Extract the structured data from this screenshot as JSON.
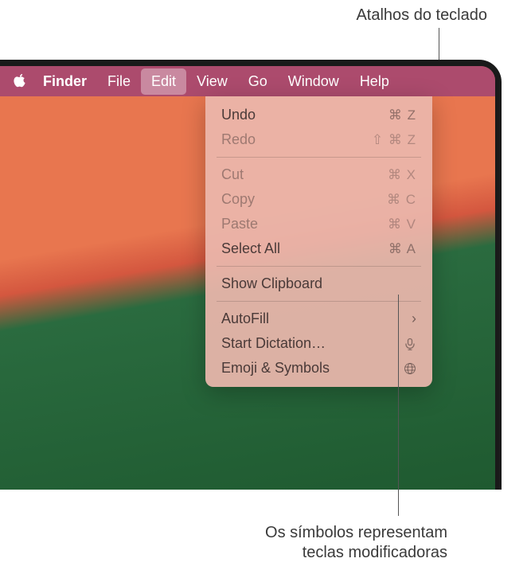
{
  "annotations": {
    "top": "Atalhos do teclado",
    "bottomLine1": "Os símbolos representam",
    "bottomLine2": "teclas modificadoras"
  },
  "menubar": {
    "appName": "Finder",
    "items": [
      "File",
      "Edit",
      "View",
      "Go",
      "Window",
      "Help"
    ],
    "selected": "Edit"
  },
  "dropdown": {
    "section1": [
      {
        "label": "Undo",
        "shortcut": "⌘ Z",
        "disabled": false
      },
      {
        "label": "Redo",
        "shortcut": "⇧ ⌘ Z",
        "disabled": true
      }
    ],
    "section2": [
      {
        "label": "Cut",
        "shortcut": "⌘ X",
        "disabled": true
      },
      {
        "label": "Copy",
        "shortcut": "⌘ C",
        "disabled": true
      },
      {
        "label": "Paste",
        "shortcut": "⌘ V",
        "disabled": true
      },
      {
        "label": "Select All",
        "shortcut": "⌘ A",
        "disabled": false
      }
    ],
    "section3": [
      {
        "label": "Show Clipboard",
        "shortcut": "",
        "disabled": false
      }
    ],
    "section4": [
      {
        "label": "AutoFill",
        "shortcut": "",
        "disabled": false,
        "submenu": true
      },
      {
        "label": "Start Dictation…",
        "shortcut": "",
        "disabled": false,
        "icon": "mic"
      },
      {
        "label": "Emoji & Symbols",
        "shortcut": "",
        "disabled": false,
        "icon": "globe"
      }
    ]
  }
}
